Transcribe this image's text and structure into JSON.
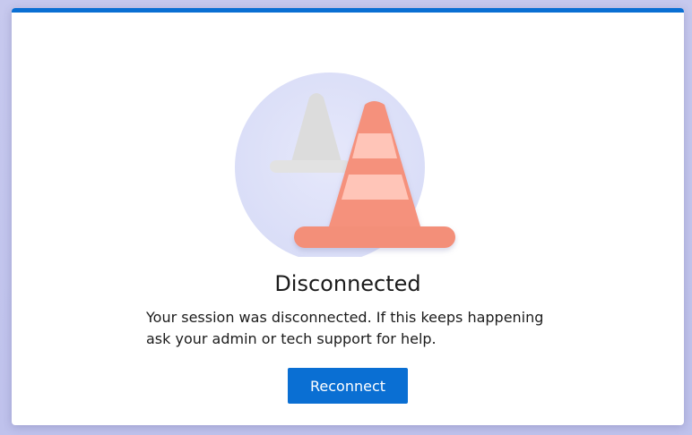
{
  "dialog": {
    "title": "Disconnected",
    "message": "Your session was disconnected. If this keeps happening ask your admin or tech support for help.",
    "reconnect_label": "Reconnect"
  },
  "illustration": {
    "icon": "traffic-cone-icon",
    "description_colors": {
      "accent": "#0a6fd3",
      "cone_orange": "#f5907a",
      "cone_light": "#ffc4b7",
      "circle": "#dfe2f8",
      "grey_cone": "#dcdcdc"
    }
  }
}
